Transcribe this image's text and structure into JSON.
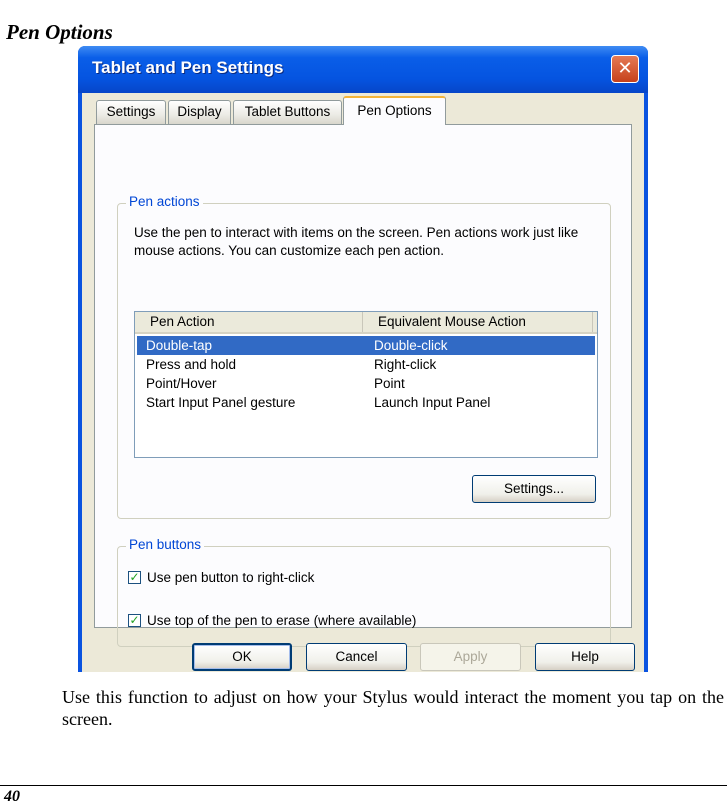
{
  "doc": {
    "section_title": "Pen Options",
    "body_text": "Use this function to adjust on how your Stylus would interact the moment you tap on the screen.",
    "page_number": "40"
  },
  "dialog": {
    "title": "Tablet and Pen Settings",
    "close_glyph": "✕",
    "tabs": [
      "Settings",
      "Display",
      "Tablet Buttons",
      "Pen Options"
    ],
    "active_tab": "Pen Options",
    "pen_actions": {
      "legend": "Pen actions",
      "description": "Use the pen to interact with items on the screen. Pen actions work just like mouse actions. You can customize each pen action.",
      "columns": [
        "Pen Action",
        "Equivalent Mouse Action"
      ],
      "rows": [
        {
          "action": "Double-tap",
          "mouse": "Double-click",
          "selected": true
        },
        {
          "action": "Press and hold",
          "mouse": "Right-click",
          "selected": false
        },
        {
          "action": "Point/Hover",
          "mouse": "Point",
          "selected": false
        },
        {
          "action": "Start Input Panel gesture",
          "mouse": "Launch Input Panel",
          "selected": false
        }
      ],
      "settings_button": "Settings..."
    },
    "pen_buttons": {
      "legend": "Pen buttons",
      "checkboxes": [
        {
          "label": "Use pen button to right-click",
          "checked": true
        },
        {
          "label": "Use top of the pen to erase (where available)",
          "checked": true
        }
      ]
    },
    "buttons": {
      "ok": "OK",
      "cancel": "Cancel",
      "apply": "Apply",
      "help": "Help"
    },
    "colors": {
      "titlebar": "#0554e0",
      "selection": "#316ac5",
      "groupbox_legend": "#0046d5"
    }
  }
}
